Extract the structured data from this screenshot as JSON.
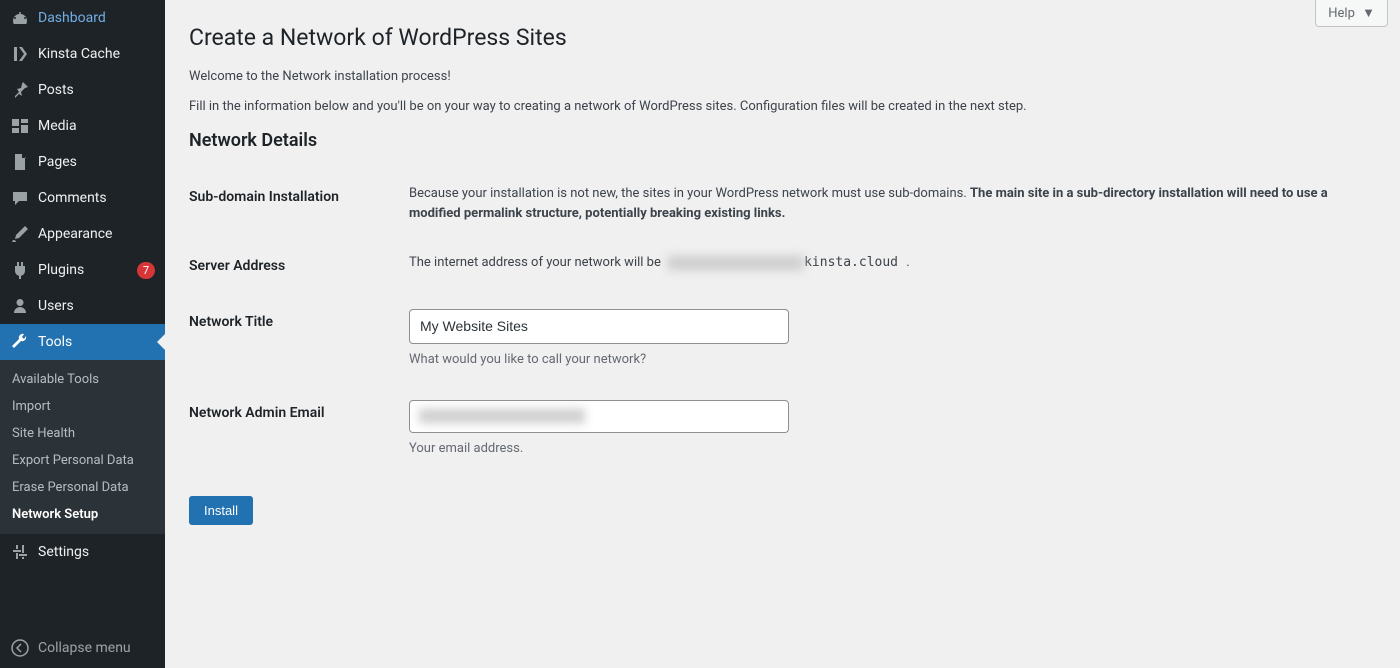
{
  "sidebar": {
    "items": [
      {
        "label": "Dashboard",
        "icon": "dashboard"
      },
      {
        "label": "Kinsta Cache",
        "icon": "kinsta"
      },
      {
        "label": "Posts",
        "icon": "pin"
      },
      {
        "label": "Media",
        "icon": "media"
      },
      {
        "label": "Pages",
        "icon": "page"
      },
      {
        "label": "Comments",
        "icon": "comment"
      },
      {
        "label": "Appearance",
        "icon": "brush"
      },
      {
        "label": "Plugins",
        "icon": "plug",
        "badge": "7"
      },
      {
        "label": "Users",
        "icon": "user"
      },
      {
        "label": "Tools",
        "icon": "wrench",
        "active": true
      },
      {
        "label": "Settings",
        "icon": "settings"
      }
    ],
    "submenu": [
      "Available Tools",
      "Import",
      "Site Health",
      "Export Personal Data",
      "Erase Personal Data",
      "Network Setup"
    ],
    "collapse_label": "Collapse menu"
  },
  "help_label": "Help",
  "page_title": "Create a Network of WordPress Sites",
  "intro": {
    "welcome": "Welcome to the Network installation process!",
    "fill": "Fill in the information below and you'll be on your way to creating a network of WordPress sites. Configuration files will be created in the next step."
  },
  "section_title": "Network Details",
  "fields": {
    "subdomain_label": "Sub-domain Installation",
    "subdomain_text_a": "Because your installation is not new, the sites in your WordPress network must use sub-domains. ",
    "subdomain_text_b": "The main site in a sub-directory installation will need to use a modified permalink structure, potentially breaking existing links.",
    "server_address_label": "Server Address",
    "server_address_text": "The internet address of your network will be ",
    "server_address_domain": "kinsta.cloud",
    "server_address_period": " .",
    "network_title_label": "Network Title",
    "network_title_value": "My Website Sites",
    "network_title_help": "What would you like to call your network?",
    "admin_email_label": "Network Admin Email",
    "admin_email_help": "Your email address."
  },
  "install_label": "Install"
}
